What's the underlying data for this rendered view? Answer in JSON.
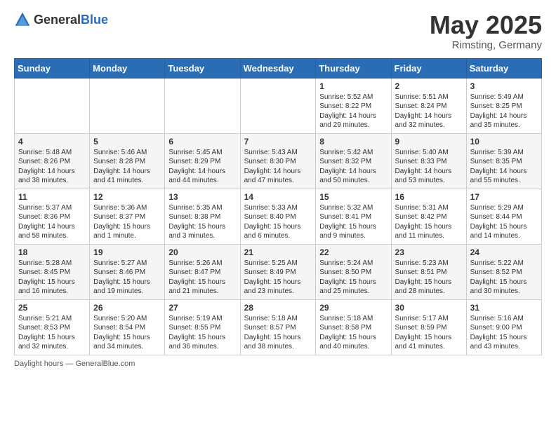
{
  "header": {
    "logo_general": "General",
    "logo_blue": "Blue",
    "month": "May 2025",
    "location": "Rimsting, Germany"
  },
  "days_of_week": [
    "Sunday",
    "Monday",
    "Tuesday",
    "Wednesday",
    "Thursday",
    "Friday",
    "Saturday"
  ],
  "weeks": [
    [
      {
        "day": "",
        "info": ""
      },
      {
        "day": "",
        "info": ""
      },
      {
        "day": "",
        "info": ""
      },
      {
        "day": "",
        "info": ""
      },
      {
        "day": "1",
        "info": "Sunrise: 5:52 AM\nSunset: 8:22 PM\nDaylight: 14 hours and 29 minutes."
      },
      {
        "day": "2",
        "info": "Sunrise: 5:51 AM\nSunset: 8:24 PM\nDaylight: 14 hours and 32 minutes."
      },
      {
        "day": "3",
        "info": "Sunrise: 5:49 AM\nSunset: 8:25 PM\nDaylight: 14 hours and 35 minutes."
      }
    ],
    [
      {
        "day": "4",
        "info": "Sunrise: 5:48 AM\nSunset: 8:26 PM\nDaylight: 14 hours and 38 minutes."
      },
      {
        "day": "5",
        "info": "Sunrise: 5:46 AM\nSunset: 8:28 PM\nDaylight: 14 hours and 41 minutes."
      },
      {
        "day": "6",
        "info": "Sunrise: 5:45 AM\nSunset: 8:29 PM\nDaylight: 14 hours and 44 minutes."
      },
      {
        "day": "7",
        "info": "Sunrise: 5:43 AM\nSunset: 8:30 PM\nDaylight: 14 hours and 47 minutes."
      },
      {
        "day": "8",
        "info": "Sunrise: 5:42 AM\nSunset: 8:32 PM\nDaylight: 14 hours and 50 minutes."
      },
      {
        "day": "9",
        "info": "Sunrise: 5:40 AM\nSunset: 8:33 PM\nDaylight: 14 hours and 53 minutes."
      },
      {
        "day": "10",
        "info": "Sunrise: 5:39 AM\nSunset: 8:35 PM\nDaylight: 14 hours and 55 minutes."
      }
    ],
    [
      {
        "day": "11",
        "info": "Sunrise: 5:37 AM\nSunset: 8:36 PM\nDaylight: 14 hours and 58 minutes."
      },
      {
        "day": "12",
        "info": "Sunrise: 5:36 AM\nSunset: 8:37 PM\nDaylight: 15 hours and 1 minute."
      },
      {
        "day": "13",
        "info": "Sunrise: 5:35 AM\nSunset: 8:38 PM\nDaylight: 15 hours and 3 minutes."
      },
      {
        "day": "14",
        "info": "Sunrise: 5:33 AM\nSunset: 8:40 PM\nDaylight: 15 hours and 6 minutes."
      },
      {
        "day": "15",
        "info": "Sunrise: 5:32 AM\nSunset: 8:41 PM\nDaylight: 15 hours and 9 minutes."
      },
      {
        "day": "16",
        "info": "Sunrise: 5:31 AM\nSunset: 8:42 PM\nDaylight: 15 hours and 11 minutes."
      },
      {
        "day": "17",
        "info": "Sunrise: 5:29 AM\nSunset: 8:44 PM\nDaylight: 15 hours and 14 minutes."
      }
    ],
    [
      {
        "day": "18",
        "info": "Sunrise: 5:28 AM\nSunset: 8:45 PM\nDaylight: 15 hours and 16 minutes."
      },
      {
        "day": "19",
        "info": "Sunrise: 5:27 AM\nSunset: 8:46 PM\nDaylight: 15 hours and 19 minutes."
      },
      {
        "day": "20",
        "info": "Sunrise: 5:26 AM\nSunset: 8:47 PM\nDaylight: 15 hours and 21 minutes."
      },
      {
        "day": "21",
        "info": "Sunrise: 5:25 AM\nSunset: 8:49 PM\nDaylight: 15 hours and 23 minutes."
      },
      {
        "day": "22",
        "info": "Sunrise: 5:24 AM\nSunset: 8:50 PM\nDaylight: 15 hours and 25 minutes."
      },
      {
        "day": "23",
        "info": "Sunrise: 5:23 AM\nSunset: 8:51 PM\nDaylight: 15 hours and 28 minutes."
      },
      {
        "day": "24",
        "info": "Sunrise: 5:22 AM\nSunset: 8:52 PM\nDaylight: 15 hours and 30 minutes."
      }
    ],
    [
      {
        "day": "25",
        "info": "Sunrise: 5:21 AM\nSunset: 8:53 PM\nDaylight: 15 hours and 32 minutes."
      },
      {
        "day": "26",
        "info": "Sunrise: 5:20 AM\nSunset: 8:54 PM\nDaylight: 15 hours and 34 minutes."
      },
      {
        "day": "27",
        "info": "Sunrise: 5:19 AM\nSunset: 8:55 PM\nDaylight: 15 hours and 36 minutes."
      },
      {
        "day": "28",
        "info": "Sunrise: 5:18 AM\nSunset: 8:57 PM\nDaylight: 15 hours and 38 minutes."
      },
      {
        "day": "29",
        "info": "Sunrise: 5:18 AM\nSunset: 8:58 PM\nDaylight: 15 hours and 40 minutes."
      },
      {
        "day": "30",
        "info": "Sunrise: 5:17 AM\nSunset: 8:59 PM\nDaylight: 15 hours and 41 minutes."
      },
      {
        "day": "31",
        "info": "Sunrise: 5:16 AM\nSunset: 9:00 PM\nDaylight: 15 hours and 43 minutes."
      }
    ]
  ],
  "footer": {
    "daylight_hours": "Daylight hours",
    "source": "GeneralBlue.com"
  }
}
